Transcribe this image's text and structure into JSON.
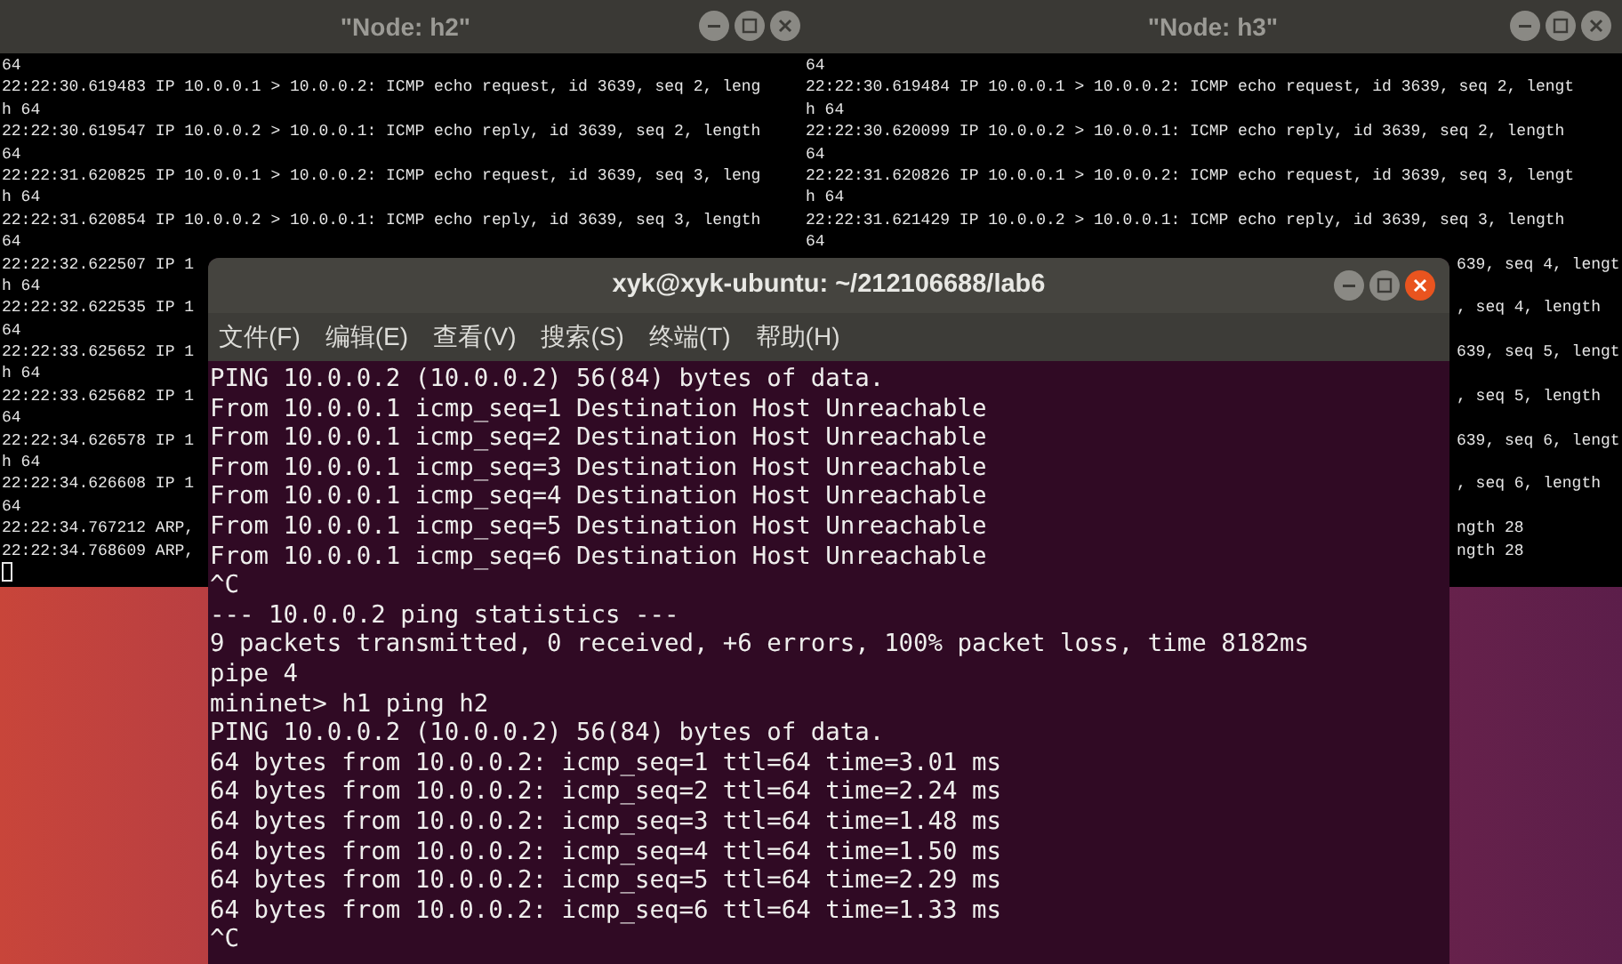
{
  "xterms": [
    {
      "title": "\"Node: h2\"",
      "cursor": true,
      "lines": [
        {
          "kind": "full",
          "text": "64"
        },
        {
          "kind": "full",
          "text": "22:22:30.619483 IP 10.0.0.1 > 10.0.0.2: ICMP echo request, id 3639, seq 2, leng"
        },
        {
          "kind": "full",
          "text": "h 64"
        },
        {
          "kind": "full",
          "text": "22:22:30.619547 IP 10.0.0.2 > 10.0.0.1: ICMP echo reply, id 3639, seq 2, length"
        },
        {
          "kind": "full",
          "text": "64"
        },
        {
          "kind": "full",
          "text": "22:22:31.620825 IP 10.0.0.1 > 10.0.0.2: ICMP echo request, id 3639, seq 3, leng"
        },
        {
          "kind": "full",
          "text": "h 64"
        },
        {
          "kind": "full",
          "text": "22:22:31.620854 IP 10.0.0.2 > 10.0.0.1: ICMP echo reply, id 3639, seq 3, length"
        },
        {
          "kind": "full",
          "text": "64"
        },
        {
          "kind": "full",
          "text": "22:22:32.622507 IP 1"
        },
        {
          "kind": "full",
          "text": "h 64"
        },
        {
          "kind": "full",
          "text": "22:22:32.622535 IP 1"
        },
        {
          "kind": "full",
          "text": "64"
        },
        {
          "kind": "full",
          "text": "22:22:33.625652 IP 1"
        },
        {
          "kind": "full",
          "text": "h 64"
        },
        {
          "kind": "full",
          "text": "22:22:33.625682 IP 1"
        },
        {
          "kind": "full",
          "text": "64"
        },
        {
          "kind": "full",
          "text": "22:22:34.626578 IP 1"
        },
        {
          "kind": "full",
          "text": "h 64"
        },
        {
          "kind": "full",
          "text": "22:22:34.626608 IP 1"
        },
        {
          "kind": "full",
          "text": "64"
        },
        {
          "kind": "full",
          "text": "22:22:34.767212 ARP,"
        },
        {
          "kind": "full",
          "text": "22:22:34.768609 ARP,"
        }
      ]
    },
    {
      "title": "\"Node: h3\"",
      "lines": [
        {
          "kind": "full",
          "text": "64"
        },
        {
          "kind": "full",
          "text": "22:22:30.619484 IP 10.0.0.1 > 10.0.0.2: ICMP echo request, id 3639, seq 2, lengt"
        },
        {
          "kind": "full",
          "text": "h 64"
        },
        {
          "kind": "full",
          "text": "22:22:30.620099 IP 10.0.0.2 > 10.0.0.1: ICMP echo reply, id 3639, seq 2, length"
        },
        {
          "kind": "full",
          "text": "64"
        },
        {
          "kind": "full",
          "text": "22:22:31.620826 IP 10.0.0.1 > 10.0.0.2: ICMP echo request, id 3639, seq 3, lengt"
        },
        {
          "kind": "full",
          "text": "h 64"
        },
        {
          "kind": "full",
          "text": "22:22:31.621429 IP 10.0.0.2 > 10.0.0.1: ICMP echo reply, id 3639, seq 3, length"
        },
        {
          "kind": "full",
          "text": "64"
        },
        {
          "kind": "tail",
          "text": "639, seq 4, lengt"
        },
        {
          "kind": "covered"
        },
        {
          "kind": "tail",
          "text": ", seq 4, length"
        },
        {
          "kind": "covered"
        },
        {
          "kind": "tail",
          "text": "639, seq 5, lengt"
        },
        {
          "kind": "covered"
        },
        {
          "kind": "tail",
          "text": ", seq 5, length"
        },
        {
          "kind": "covered"
        },
        {
          "kind": "tail",
          "text": "639, seq 6, lengt"
        },
        {
          "kind": "covered"
        },
        {
          "kind": "tail",
          "text": ", seq 6, length"
        },
        {
          "kind": "covered"
        },
        {
          "kind": "tail",
          "text": "ngth 28"
        },
        {
          "kind": "tail",
          "text": "ngth 28"
        }
      ]
    }
  ],
  "terminal": {
    "title": "xyk@xyk-ubuntu: ~/212106688/lab6",
    "menu": [
      "文件(F)",
      "编辑(E)",
      "查看(V)",
      "搜索(S)",
      "终端(T)",
      "帮助(H)"
    ],
    "lines": [
      "PING 10.0.0.2 (10.0.0.2) 56(84) bytes of data.",
      "From 10.0.0.1 icmp_seq=1 Destination Host Unreachable",
      "From 10.0.0.1 icmp_seq=2 Destination Host Unreachable",
      "From 10.0.0.1 icmp_seq=3 Destination Host Unreachable",
      "From 10.0.0.1 icmp_seq=4 Destination Host Unreachable",
      "From 10.0.0.1 icmp_seq=5 Destination Host Unreachable",
      "From 10.0.0.1 icmp_seq=6 Destination Host Unreachable",
      "^C",
      "--- 10.0.0.2 ping statistics ---",
      "9 packets transmitted, 0 received, +6 errors, 100% packet loss, time 8182ms",
      "pipe 4",
      "mininet> h1 ping h2",
      "PING 10.0.0.2 (10.0.0.2) 56(84) bytes of data.",
      "64 bytes from 10.0.0.2: icmp_seq=1 ttl=64 time=3.01 ms",
      "64 bytes from 10.0.0.2: icmp_seq=2 ttl=64 time=2.24 ms",
      "64 bytes from 10.0.0.2: icmp_seq=3 ttl=64 time=1.48 ms",
      "64 bytes from 10.0.0.2: icmp_seq=4 ttl=64 time=1.50 ms",
      "64 bytes from 10.0.0.2: icmp_seq=5 ttl=64 time=2.29 ms",
      "64 bytes from 10.0.0.2: icmp_seq=6 ttl=64 time=1.33 ms",
      "^C"
    ]
  }
}
